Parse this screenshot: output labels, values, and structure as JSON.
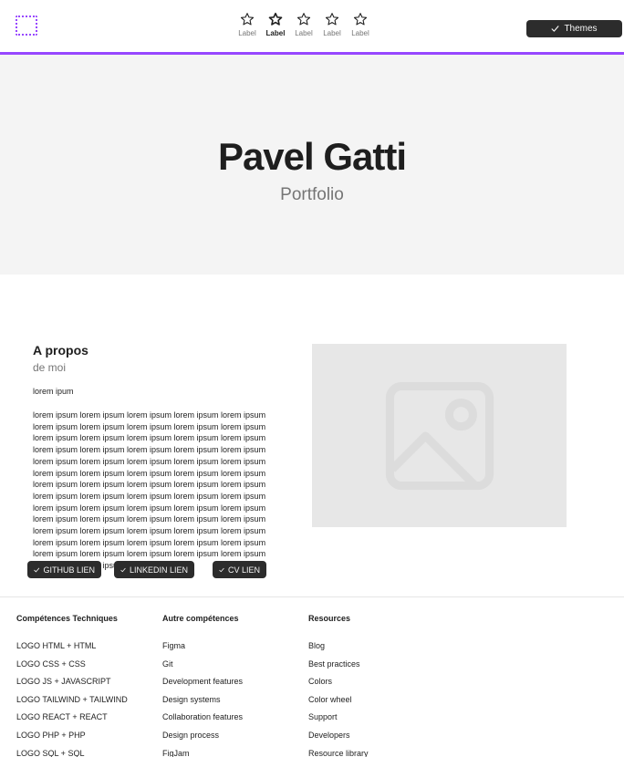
{
  "nav": {
    "tabs": [
      {
        "label": "Label",
        "icon": "star-icon",
        "active": false
      },
      {
        "label": "Label",
        "icon": "star-icon",
        "active": true
      },
      {
        "label": "Label",
        "icon": "star-icon",
        "active": false
      },
      {
        "label": "Label",
        "icon": "star-icon",
        "active": false
      },
      {
        "label": "Label",
        "icon": "star-icon",
        "active": false
      }
    ],
    "themes_button": "Themes",
    "accent_color": "#9747ff"
  },
  "hero": {
    "title": "Pavel Gatti",
    "subtitle": "Portfolio",
    "background": "#f4f4f4"
  },
  "about": {
    "title": "A propos",
    "subtitle": "de moi",
    "intro": "lorem ipum",
    "body": "lorem ipsum lorem ipsum lorem ipsum lorem ipsum lorem ipsum lorem ipsum lorem ipsum lorem ipsum lorem ipsum lorem ipsum lorem ipsum lorem ipsum lorem ipsum lorem ipsum lorem ipsum lorem ipsum lorem ipsum lorem ipsum lorem ipsum lorem ipsum lorem ipsum lorem ipsum lorem ipsum lorem ipsum lorem ipsum lorem ipsum lorem ipsum lorem ipsum lorem ipsum lorem ipsum lorem ipsum lorem ipsum lorem ipsum lorem ipsum lorem ipsum lorem ipsum lorem ipsum lorem ipsum lorem ipsum lorem ipsum lorem ipsum lorem ipsum lorem ipsum lorem ipsum lorem ipsum lorem ipsum lorem ipsum lorem ipsum lorem ipsum lorem ipsum lorem ipsum lorem ipsum lorem ipsum lorem ipsum lorem ipsum lorem ipsum lorem ipsum lorem ipsum lorem ipsum lorem ipsum lorem ipsum lorem ipsum lorem ipsum lorem ipsum lorem ipsum lorem ipsum lorem ipsum",
    "links": [
      "GITHUB LIEN",
      "LINKEDIN LIEN",
      "CV LIEN"
    ],
    "image_icon": "image-placeholder-icon"
  },
  "footer": {
    "columns": [
      {
        "title": "Compétences Techniques",
        "items": [
          "LOGO HTML + HTML",
          "LOGO CSS + CSS",
          "LOGO JS + JAVASCRIPT",
          "LOGO TAILWIND + TAILWIND",
          "LOGO REACT + REACT",
          "LOGO PHP + PHP",
          "LOGO SQL + SQL"
        ]
      },
      {
        "title": "Autre compétences",
        "items": [
          "Figma",
          "Git",
          "Development features",
          "Design systems",
          "Collaboration features",
          "Design process",
          "FigJam"
        ]
      },
      {
        "title": "Resources",
        "items": [
          "Blog",
          "Best practices",
          "Colors",
          "Color wheel",
          "Support",
          "Developers",
          "Resource library"
        ]
      }
    ]
  }
}
